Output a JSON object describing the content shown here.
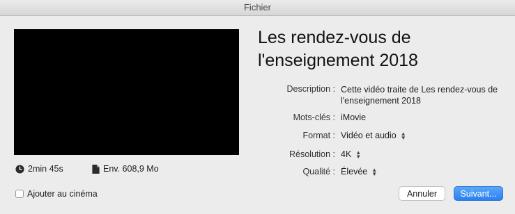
{
  "window": {
    "title": "Fichier"
  },
  "media": {
    "duration": "2min 45s",
    "size": "Env. 608,9 Mo",
    "duration_icon": "clock-icon",
    "size_icon": "document-icon"
  },
  "project": {
    "title": "Les rendez-vous de l'enseignement 2018"
  },
  "properties": {
    "description_label": "Description :",
    "description_value": "Cette vidéo traite de Les rendez-vous de l'enseignement 2018",
    "keywords_label": "Mots-clés :",
    "keywords_value": "iMovie",
    "format_label": "Format :",
    "format_value": "Vidéo et audio",
    "resolution_label": "Résolution :",
    "resolution_value": "4K",
    "quality_label": "Qualité :",
    "quality_value": "Élevée"
  },
  "options": {
    "add_to_theater_label": "Ajouter au cinéma",
    "add_to_theater_checked": false
  },
  "buttons": {
    "cancel": "Annuler",
    "next": "Suivant..."
  },
  "colors": {
    "primary_button": "#2a80f0",
    "window_bg": "#ececec"
  }
}
